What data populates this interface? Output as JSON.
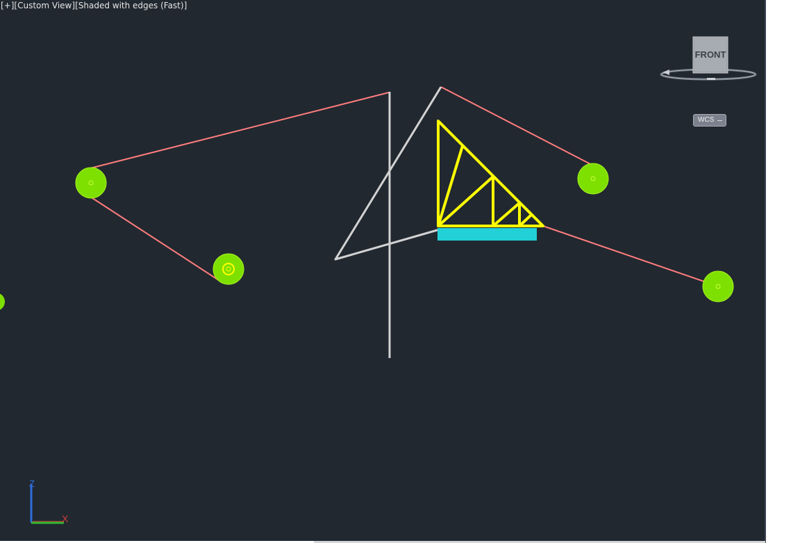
{
  "viewport": {
    "controls_label": "[+]",
    "view_label": "[Custom View]",
    "visual_style_label": "[Shaded with edges (Fast)]",
    "background_color": "#212830"
  },
  "viewcube": {
    "face_label": "FRONT",
    "coordinate_system_label": "WCS"
  },
  "ucs_icon": {
    "z_label": "Z",
    "x_label": "X"
  },
  "scene_colors": {
    "wire": "#ff7d7d",
    "node": "#7ee000",
    "truss": "#ffff00",
    "base_plate": "#22d0d8",
    "mast": "#d2d2d2"
  }
}
